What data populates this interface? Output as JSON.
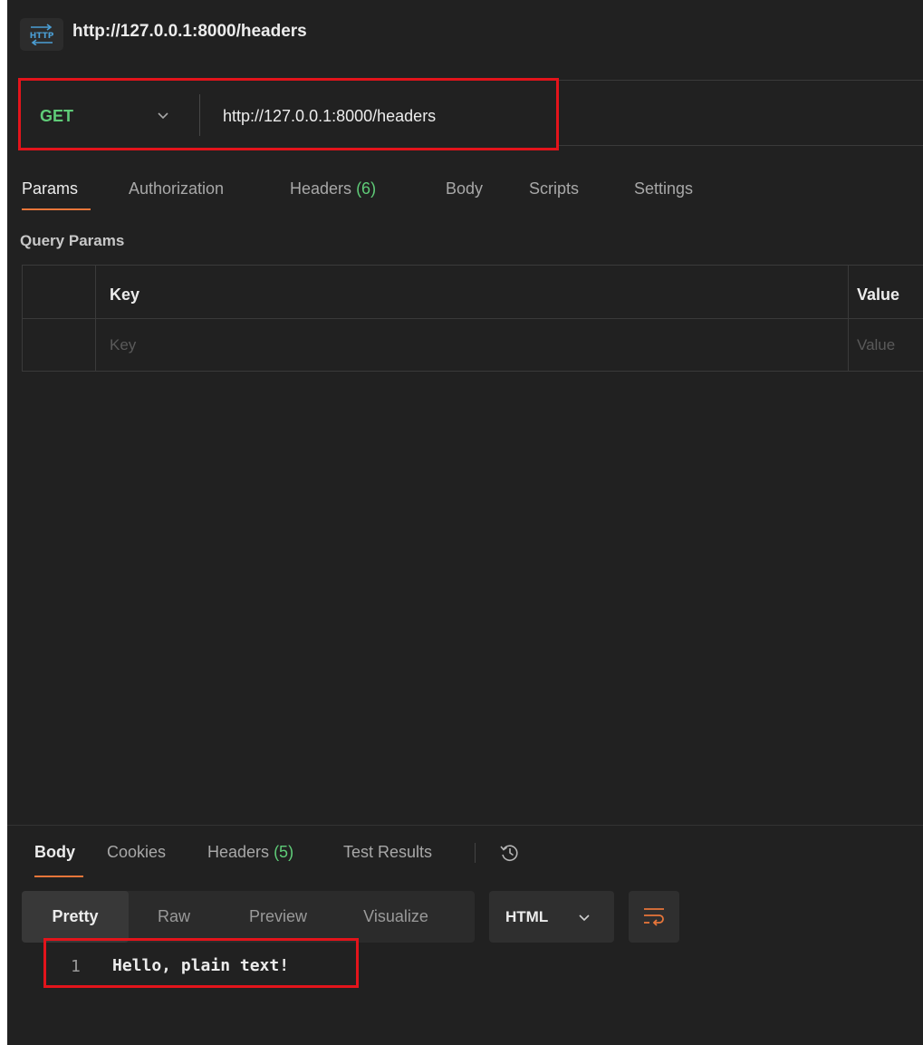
{
  "window": {
    "title": "http://127.0.0.1:8000/headers"
  },
  "icons": {
    "http": "http-request-icon",
    "method_chevron": "chevron-down-icon",
    "history": "history-icon",
    "format_chevron": "chevron-down-icon",
    "wrap": "wrap-lines-icon"
  },
  "request": {
    "method": "GET",
    "url": "http://127.0.0.1:8000/headers"
  },
  "request_tabs": [
    {
      "label": "Params",
      "active": true
    },
    {
      "label": "Authorization"
    },
    {
      "label": "Headers",
      "count": "(6)"
    },
    {
      "label": "Body"
    },
    {
      "label": "Scripts"
    },
    {
      "label": "Settings"
    }
  ],
  "query_params": {
    "section_label": "Query Params",
    "columns": [
      "Key",
      "Value"
    ],
    "placeholders": [
      "Key",
      "Value"
    ]
  },
  "response_tabs": [
    {
      "label": "Body",
      "active": true
    },
    {
      "label": "Cookies"
    },
    {
      "label": "Headers",
      "count": "(5)"
    },
    {
      "label": "Test Results"
    }
  ],
  "view_modes": [
    {
      "label": "Pretty",
      "active": true
    },
    {
      "label": "Raw"
    },
    {
      "label": "Preview"
    },
    {
      "label": "Visualize"
    }
  ],
  "format": {
    "label": "HTML"
  },
  "response_body": [
    {
      "line": "1",
      "text": "Hello, plain text!"
    }
  ],
  "colors": {
    "background": "#212121",
    "method": "#5fcc78",
    "tab_accent": "#e8763a",
    "highlight_box": "#e3141b"
  }
}
